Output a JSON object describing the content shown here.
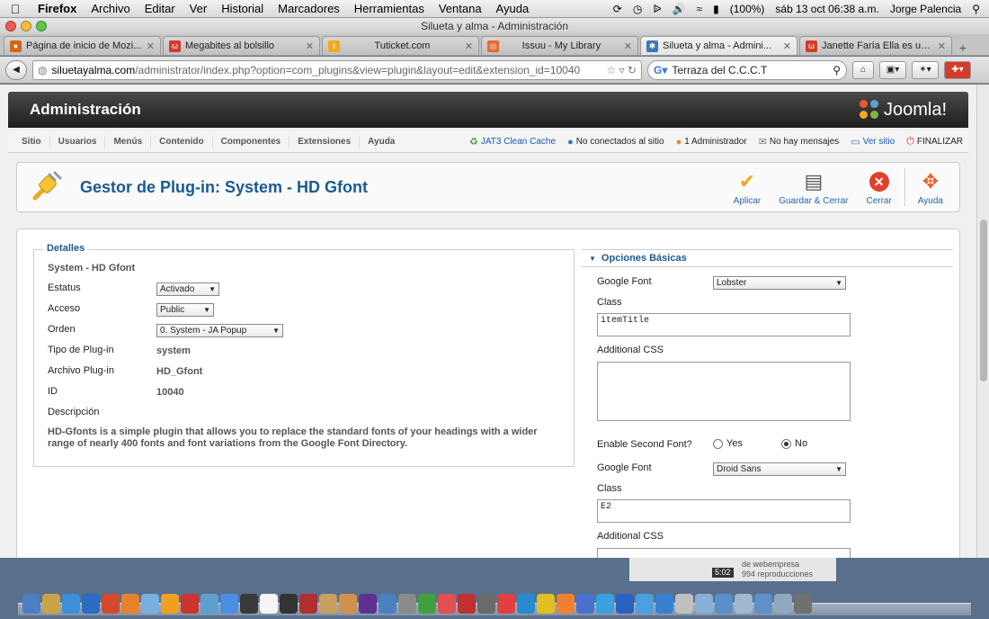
{
  "menubar": {
    "app": "Firefox",
    "items": [
      "Archivo",
      "Editar",
      "Ver",
      "Historial",
      "Marcadores",
      "Herramientas",
      "Ventana",
      "Ayuda"
    ],
    "battery": "(100%)",
    "datetime": "sáb 13 oct  06:38 a.m.",
    "user": "Jorge Palencia"
  },
  "window": {
    "title": "Silueta y alma - Administración"
  },
  "tabs": [
    {
      "label": "Página de inicio de Mozi...",
      "favicon_color": "#d0671b",
      "active": false
    },
    {
      "label": "Megabites al bolsillo",
      "favicon_color": "#d63a2a",
      "active": false
    },
    {
      "label": "Tuticket.com",
      "favicon_color": "#f2a81e",
      "active": false
    },
    {
      "label": "Issuu - My Library",
      "favicon_color": "#e86a2c",
      "active": false
    },
    {
      "label": "Silueta y alma - Admini...",
      "favicon_color": "#3a78b8",
      "active": true
    },
    {
      "label": "Janette Faría Ella es una...",
      "favicon_color": "#d63a2a",
      "active": false
    }
  ],
  "navbar": {
    "url_domain": "siluetayalma.com",
    "url_path": "/administrator/index.php?option=com_plugins&view=plugin&layout=edit&extension_id=10040",
    "search_value": "Terraza del C.C.C.T"
  },
  "joomla": {
    "admin_title": "Administración",
    "logo_text": "Joomla!",
    "menu": [
      "Sitio",
      "Usuarios",
      "Menús",
      "Contenido",
      "Componentes",
      "Extensiones",
      "Ayuda"
    ],
    "status": {
      "cache": "JAT3 Clean Cache",
      "visitors": "No conectados al sitio",
      "admins": "1 Administrador",
      "messages": "No hay mensajes",
      "view_site": "Ver sitio",
      "logout": "FINALIZAR"
    },
    "page_title": "Gestor de Plug-in: System - HD Gfont",
    "buttons": {
      "apply": "Aplicar",
      "save_close": "Guardar & Cerrar",
      "close": "Cerrar",
      "help": "Ayuda"
    }
  },
  "details": {
    "legend": "Detalles",
    "plugin_name": "System - HD Gfont",
    "status_label": "Estatus",
    "status_value": "Activado",
    "access_label": "Acceso",
    "access_value": "Public",
    "order_label": "Orden",
    "order_value": "0. System - JA Popup",
    "type_label": "Tipo de Plug-in",
    "type_value": "system",
    "file_label": "Archivo Plug-in",
    "file_value": "HD_Gfont",
    "id_label": "ID",
    "id_value": "10040",
    "desc_label": "Descripción",
    "desc_value": "HD-Gfonts is a simple plugin that allows you to replace the standard fonts of your headings with a wider range of nearly 400 fonts and font variations from the Google Font Directory."
  },
  "options": {
    "heading": "Opciones Básicas",
    "google_font_label": "Google Font",
    "google_font_value": "Lobster",
    "class_label": "Class",
    "class_value": "itemTitle",
    "css_label": "Additional CSS",
    "css_value": "",
    "second_font_label": "Enable Second Font?",
    "yes_label": "Yes",
    "no_label": "No",
    "second_font_selected": "No",
    "google_font2_label": "Google Font",
    "google_font2_value": "Droid Sans",
    "class2_label": "Class",
    "class2_value": "E2",
    "css2_label": "Additional CSS"
  },
  "desktop": {
    "card_line1": "de webempresa",
    "card_line2": "994 reproducciones",
    "card_duration": "5:02"
  },
  "dock_colors": [
    "#4a7fc1",
    "#c9a24a",
    "#3c8fd8",
    "#2d6bc4",
    "#d44a2a",
    "#e8822a",
    "#7ab0e0",
    "#f0a020",
    "#cc3333",
    "#60a0d0",
    "#4a90e2",
    "#3a3a3a",
    "#f5f5f5",
    "#333333",
    "#b03030",
    "#c8a060",
    "#d09050",
    "#603090",
    "#4a80c0",
    "#8a8a8a",
    "#40a040",
    "#e05050",
    "#c03030",
    "#6a6a6a",
    "#e04040",
    "#2a8ad0",
    "#e0c020",
    "#f08030",
    "#4a70d0",
    "#3aa0e0",
    "#2a60c0",
    "#4aa0e0",
    "#3a80d0",
    "#c0c0c0",
    "#8ab0d8",
    "#5a90c8",
    "#a0b8d0",
    "#6090c8",
    "#90a8c0",
    "#707070"
  ]
}
